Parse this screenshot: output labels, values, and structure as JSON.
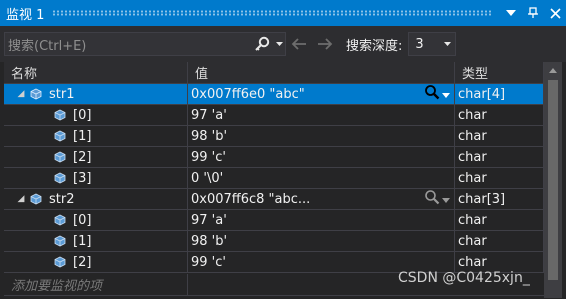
{
  "window": {
    "title": "监视 1",
    "pin_icon": "dropdown-arrow-icon",
    "colors": {
      "titlebar": "#007acc",
      "background": "#252526",
      "selection": "#007acc"
    }
  },
  "search": {
    "placeholder": "搜索(Ctrl+E)",
    "depth_label": "搜索深度:",
    "depth_value": "3"
  },
  "columns": {
    "name": "名称",
    "value": "值",
    "type": "类型"
  },
  "rows": [
    {
      "name": "str1",
      "value": "0x007ff6e0 \"abc\"",
      "type": "char[4]"
    },
    {
      "name": "[0]",
      "value": "97 'a'",
      "type": "char"
    },
    {
      "name": "[1]",
      "value": "98 'b'",
      "type": "char"
    },
    {
      "name": "[2]",
      "value": "99 'c'",
      "type": "char"
    },
    {
      "name": "[3]",
      "value": "0 '\\0'",
      "type": "char"
    },
    {
      "name": "str2",
      "value": "0x007ff6c8 \"abc...",
      "type": "char[3]"
    },
    {
      "name": "[0]",
      "value": "97 'a'",
      "type": "char"
    },
    {
      "name": "[1]",
      "value": "98 'b'",
      "type": "char"
    },
    {
      "name": "[2]",
      "value": "99 'c'",
      "type": "char"
    }
  ],
  "add_watch_placeholder": "添加要监视的项",
  "watermark": "CSDN @C0425xjn_"
}
